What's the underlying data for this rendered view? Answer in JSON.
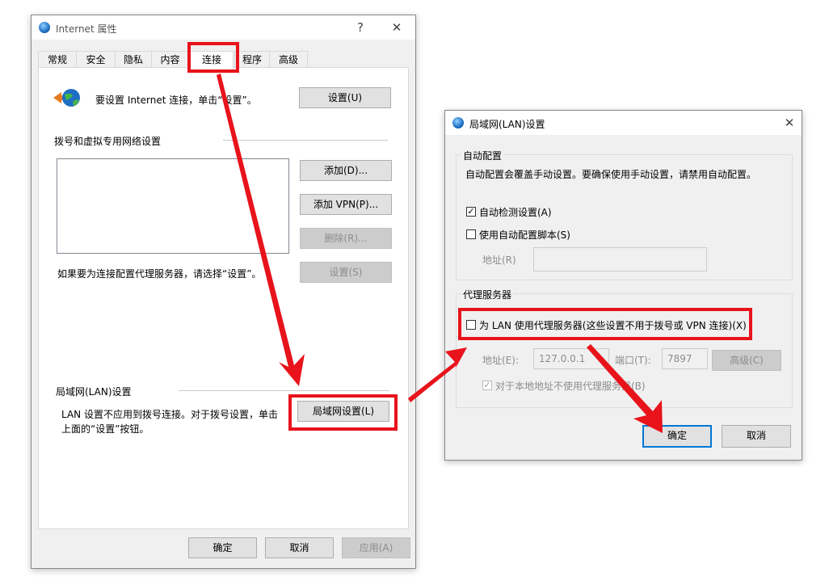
{
  "internet_props": {
    "title": "Internet 属性",
    "help_glyph": "?",
    "close_glyph": "✕",
    "tabs": [
      "常规",
      "安全",
      "隐私",
      "内容",
      "连接",
      "程序",
      "高级"
    ],
    "active_tab": "连接",
    "setup_text": "要设置 Internet 连接，单击“设置”。",
    "setup_button": "设置(U)",
    "dialup_section": "拨号和虚拟专用网络设置",
    "add_button": "添加(D)...",
    "add_vpn_button": "添加 VPN(P)...",
    "remove_button": "删除(R)...",
    "settings_button": "设置(S)",
    "proxy_hint": "如果要为连接配置代理服务器，请选择“设置”。",
    "lan_section": "局域网(LAN)设置",
    "lan_text_line1": "LAN 设置不应用到拨号连接。对于拨号设置，单击",
    "lan_text_line2": "上面的“设置”按钮。",
    "lan_button": "局域网设置(L)",
    "ok_button": "确定",
    "cancel_button": "取消",
    "apply_button": "应用(A)"
  },
  "lan_dialog": {
    "title": "局域网(LAN)设置",
    "close_glyph": "✕",
    "auto_config_group": "自动配置",
    "auto_config_desc": "自动配置会覆盖手动设置。要确保使用手动设置，请禁用自动配置。",
    "auto_detect_label": "自动检测设置(A)",
    "auto_detect_checked": true,
    "auto_script_label": "使用自动配置脚本(S)",
    "auto_script_checked": false,
    "script_address_label": "地址(R)",
    "proxy_group": "代理服务器",
    "use_proxy_label": "为 LAN 使用代理服务器(这些设置不用于拨号或 VPN 连接)(X)",
    "use_proxy_checked": false,
    "address_label": "地址(E):",
    "address_value": "127.0.0.1",
    "port_label": "端口(T):",
    "port_value": "7897",
    "advanced_button": "高级(C)",
    "bypass_label": "对于本地地址不使用代理服务器(B)",
    "bypass_checked": true,
    "check_glyph": "✓",
    "ok_button": "确定",
    "cancel_button": "取消"
  },
  "annotation": {
    "highlight_color": "#e8131b"
  }
}
